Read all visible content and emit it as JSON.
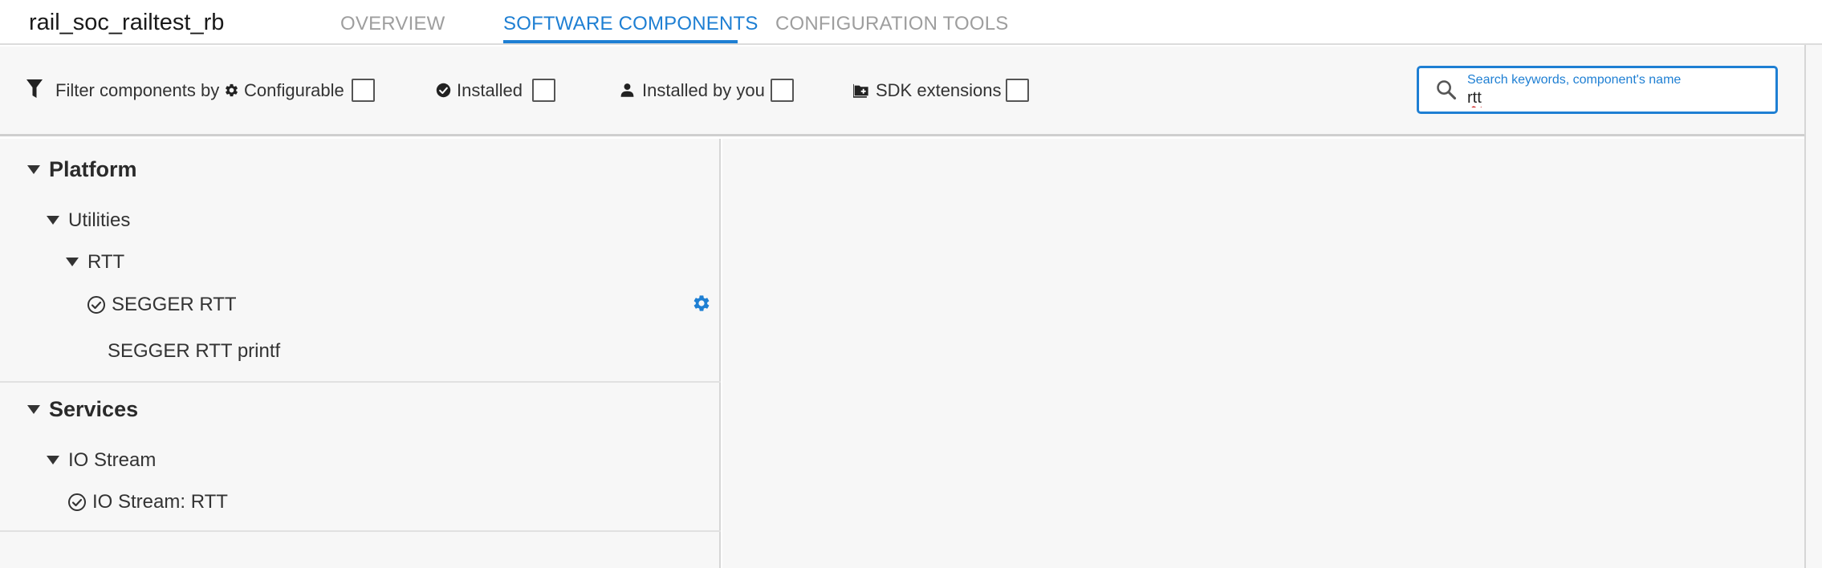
{
  "header": {
    "project_title": "rail_soc_railtest_rb",
    "tabs": [
      {
        "label": "OVERVIEW",
        "active": false
      },
      {
        "label": "SOFTWARE COMPONENTS",
        "active": true
      },
      {
        "label": "CONFIGURATION TOOLS",
        "active": false
      }
    ]
  },
  "filters": {
    "label": "Filter components by",
    "options": [
      {
        "label": "Configurable",
        "icon": "gear-icon",
        "checked": false
      },
      {
        "label": "Installed",
        "icon": "check-circle-icon",
        "checked": false
      },
      {
        "label": "Installed by you",
        "icon": "person-icon",
        "checked": false
      },
      {
        "label": "SDK extensions",
        "icon": "folder-plus-icon",
        "checked": false
      }
    ]
  },
  "search": {
    "placeholder": "Search keywords, component's name",
    "value": "rtt"
  },
  "tree": {
    "groups": [
      {
        "label": "Platform",
        "children": [
          {
            "label": "Utilities",
            "children": [
              {
                "label": "RTT",
                "components": [
                  {
                    "label": "SEGGER RTT",
                    "installed": true,
                    "configurable": true
                  },
                  {
                    "label": "SEGGER RTT printf",
                    "installed": false,
                    "configurable": false
                  }
                ]
              }
            ]
          }
        ]
      },
      {
        "label": "Services",
        "children": [
          {
            "label": "IO Stream",
            "components": [
              {
                "label": "IO Stream: RTT",
                "installed": true,
                "configurable": false
              }
            ]
          }
        ]
      }
    ]
  },
  "colors": {
    "accent": "#1e7fd3",
    "text": "#333333",
    "panel_bg": "#f7f7f7"
  }
}
